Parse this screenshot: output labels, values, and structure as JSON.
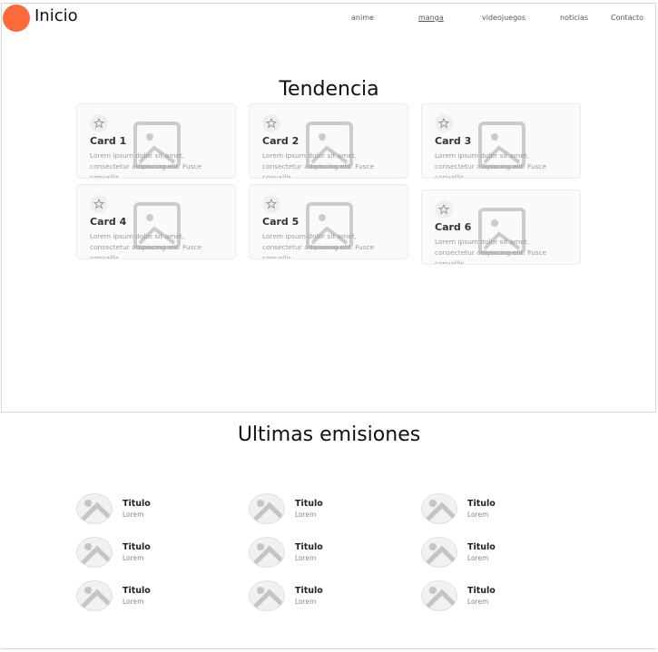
{
  "header": {
    "brand": "Inicio",
    "nav": [
      "anime",
      "manga",
      "videojuegos",
      "noticias",
      "Contacto"
    ],
    "accent": "#ff6a3c"
  },
  "trending": {
    "title": "Tendencia",
    "cards": [
      {
        "title": "Card 1",
        "text": "Lorem ipsum dolor sit amet, consectetur adipiscing elit. Fusce convallis"
      },
      {
        "title": "Card 2",
        "text": "Lorem ipsum dolor sit amet, consectetur adipiscing elit. Fusce convallis"
      },
      {
        "title": "Card 3",
        "text": "Lorem ipsum dolor sit amet, consectetur adipiscing elit. Fusce convallis"
      },
      {
        "title": "Card 4",
        "text": "Lorem ipsum dolor sit amet, consectetur adipiscing elit. Fusce convallis"
      },
      {
        "title": "Card 5",
        "text": "Lorem ipsum dolor sit amet, consectetur adipiscing elit. Fusce convallis"
      },
      {
        "title": "Card 6",
        "text": "Lorem ipsum dolor sit amet, consectetur adipiscing elit. Fusce convallis"
      }
    ]
  },
  "latest": {
    "title": "Ultimas emisiones",
    "items": [
      {
        "title": "Titulo",
        "sub": "Lorem"
      },
      {
        "title": "Titulo",
        "sub": "Lorem"
      },
      {
        "title": "Titulo",
        "sub": "Lorem"
      },
      {
        "title": "Titulo",
        "sub": "Lorem"
      },
      {
        "title": "Titulo",
        "sub": "Lorem"
      },
      {
        "title": "Titulo",
        "sub": "Lorem"
      },
      {
        "title": "Titulo",
        "sub": "Lorem"
      },
      {
        "title": "Titulo",
        "sub": "Lorem"
      },
      {
        "title": "Titulo",
        "sub": "Lorem"
      }
    ]
  }
}
